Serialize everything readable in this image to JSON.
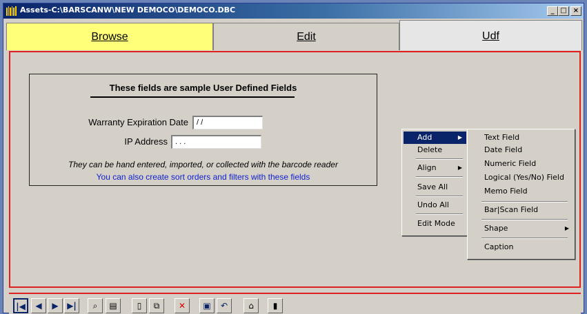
{
  "window": {
    "title": "Assets-C:\\BARSCANW\\NEW DEMOCO\\DEMOCO.DBC",
    "controls": {
      "minimize": "_",
      "maximize": "□",
      "close": "×"
    }
  },
  "tabs": [
    {
      "label": "Browse"
    },
    {
      "label": "Edit"
    },
    {
      "label": "Udf"
    }
  ],
  "udf_box": {
    "heading": "These fields are sample User Defined Fields",
    "fields": [
      {
        "label": "Warranty Expiration Date",
        "value": "/ /"
      },
      {
        "label": "IP Address",
        "value": ". . ."
      }
    ],
    "note_italic": "They can be hand entered, imported, or collected with the barcode reader",
    "note_blue": "You can also create sort orders and filters with these fields"
  },
  "context_menu": {
    "items": [
      {
        "label": "Add",
        "has_submenu": true,
        "selected": true
      },
      {
        "label": "Delete"
      },
      {
        "label": "Align",
        "has_submenu": true
      },
      {
        "label": "Save All"
      },
      {
        "label": "Undo All"
      },
      {
        "label": "Edit Mode"
      }
    ]
  },
  "add_submenu": {
    "items": [
      {
        "label": "Text Field"
      },
      {
        "label": "Date Field"
      },
      {
        "label": "Numeric Field"
      },
      {
        "label": "Logical (Yes/No) Field"
      },
      {
        "label": "Memo Field"
      },
      {
        "label": "Bar|Scan Field"
      },
      {
        "label": "Shape",
        "has_submenu": true
      },
      {
        "label": "Caption"
      }
    ]
  },
  "toolbar": {
    "buttons": [
      {
        "icon": "first-record-icon",
        "glyph": "|◀"
      },
      {
        "icon": "previous-record-icon",
        "glyph": "◀"
      },
      {
        "icon": "next-record-icon",
        "glyph": "▶"
      },
      {
        "icon": "last-record-icon",
        "glyph": "▶|"
      },
      {
        "icon": "find-binoculars-icon",
        "glyph": "⌕"
      },
      {
        "icon": "filter-icon",
        "glyph": "▤"
      },
      {
        "icon": "new-record-icon",
        "glyph": "▯"
      },
      {
        "icon": "copy-record-icon",
        "glyph": "⧉"
      },
      {
        "icon": "delete-record-icon",
        "glyph": "✕"
      },
      {
        "icon": "save-disk-icon",
        "glyph": "▣"
      },
      {
        "icon": "undo-icon",
        "glyph": "↶"
      },
      {
        "icon": "home-icon",
        "glyph": "⌂"
      },
      {
        "icon": "exit-door-icon",
        "glyph": "▮"
      }
    ]
  },
  "colors": {
    "active_tab": "#ffff7a",
    "panel_border": "#e02020",
    "menu_highlight": "#0a246a",
    "note_blue": "#1020d0"
  }
}
